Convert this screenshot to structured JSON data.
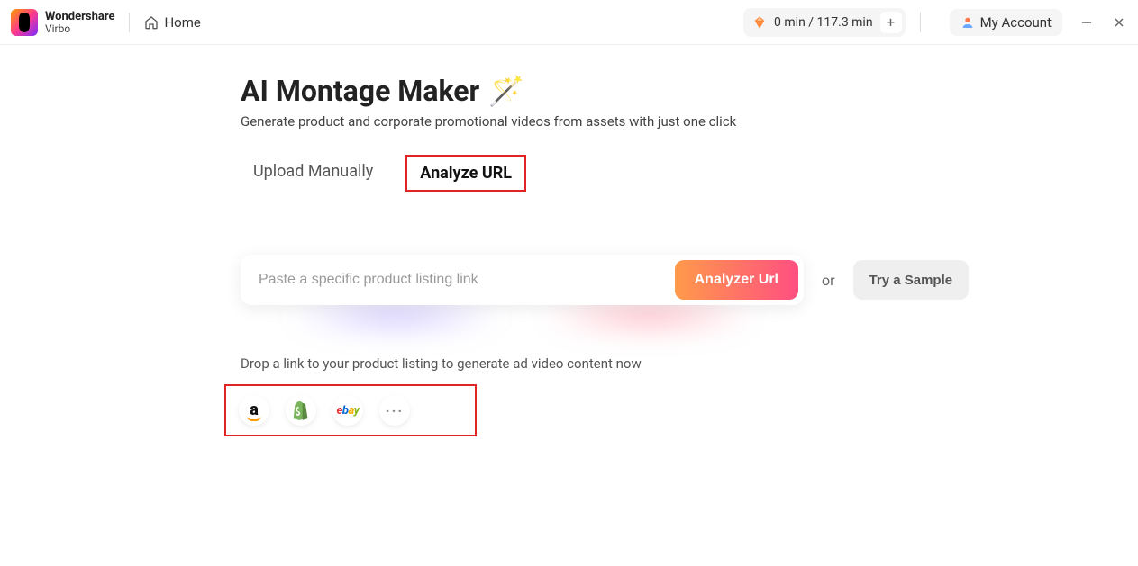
{
  "header": {
    "brand_line1": "Wondershare",
    "brand_line2": "Virbo",
    "home_label": "Home",
    "credit_text": "0 min / 117.3 min",
    "plus_label": "+",
    "account_label": "My Account"
  },
  "page": {
    "title": "AI Montage Maker",
    "title_emoji": "🪄",
    "subtitle": "Generate product and corporate promotional videos from assets with just one click"
  },
  "tabs": {
    "upload_label": "Upload Manually",
    "analyze_label": "Analyze URL"
  },
  "url_row": {
    "placeholder": "Paste a specific product listing link",
    "analyze_button": "Analyzer Url",
    "or_text": "or",
    "sample_button": "Try a Sample"
  },
  "helper_text": "Drop a link to your product listing to generate ad video content now",
  "brands": {
    "amazon": "amazon",
    "shopify": "shopify",
    "ebay": "ebay",
    "more": "···"
  }
}
